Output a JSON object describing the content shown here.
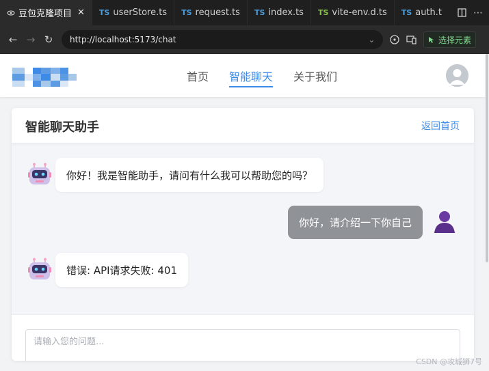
{
  "browser": {
    "tabs": [
      {
        "label": "豆包克隆项目",
        "active": true,
        "icon": "eye-icon"
      },
      {
        "label": "userStore.ts",
        "prefix": "TS"
      },
      {
        "label": "request.ts",
        "prefix": "TS"
      },
      {
        "label": "index.ts",
        "prefix": "TS"
      },
      {
        "label": "vite-env.d.ts",
        "prefix": "TS"
      },
      {
        "label": "auth.t",
        "prefix": "TS"
      }
    ],
    "url": "http://localhost:5173/chat",
    "select_element_label": "选择元素"
  },
  "header": {
    "nav": [
      {
        "label": "首页"
      },
      {
        "label": "智能聊天",
        "active": true
      },
      {
        "label": "关于我们"
      }
    ]
  },
  "chat": {
    "title": "智能聊天助手",
    "back_label": "返回首页",
    "messages": [
      {
        "role": "bot",
        "text": "你好！我是智能助手，请问有什么我可以帮助您的吗？"
      },
      {
        "role": "user",
        "text": "你好，请介绍一下你自己"
      },
      {
        "role": "bot",
        "text": "错误: API请求失败: 401"
      }
    ],
    "input_placeholder": "请输入您的问题..."
  },
  "watermark": "CSDN @攻城狮7号",
  "colors": {
    "accent": "#3d8be6",
    "user_bubble": "#8f9296",
    "page_bg": "#f2f3f5"
  }
}
